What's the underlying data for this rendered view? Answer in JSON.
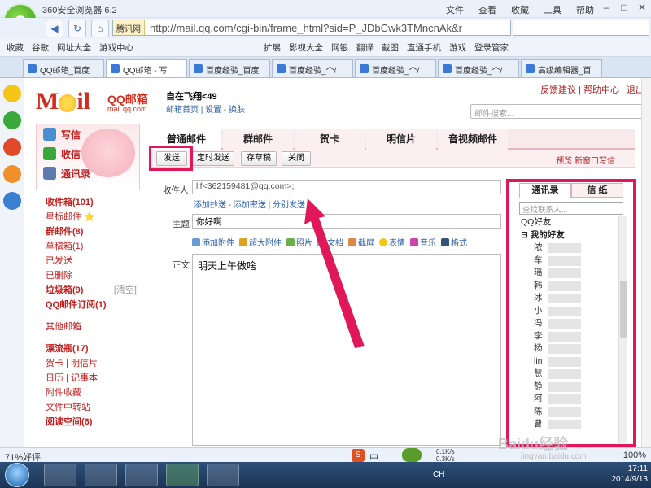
{
  "browser": {
    "title": "360安全浏览器 6.2",
    "menu": [
      "文件",
      "查看",
      "收藏",
      "工具",
      "帮助"
    ],
    "site_badge": "腾讯网",
    "url": "http://mail.qq.com/cgi-bin/frame_html?sid=P_JDbCwk3TMncnAk&r",
    "bookmarks": [
      "收藏",
      "谷歌",
      "网址大全",
      "游戏中心"
    ],
    "bookmarks_right": [
      "扩展",
      "影视大全",
      "网银",
      "翻译",
      "截图",
      "直通手机",
      "游戏",
      "登录管家"
    ],
    "tabs": [
      "QQ邮箱_百度",
      "QQ邮箱 - 写",
      "百度经验_百度",
      "百度经验_个/",
      "百度经验_个/",
      "百度经验_个/",
      "高级编辑器_百"
    ]
  },
  "mail": {
    "logo_text": "QQ邮箱",
    "logo_sub": "mail.qq.com",
    "username": "自在飞翔<49",
    "user_links": "邮箱首页 | 设置 - 换肤",
    "top_links": "反馈建议 | 帮助中心 | 退出",
    "search_placeholder": "邮件搜索...",
    "quick": [
      "写信",
      "收信",
      "通讯录"
    ],
    "folders": [
      {
        "label": "收件箱(101)",
        "bold": true
      },
      {
        "label": "星标邮件 ⭐",
        "bold": false
      },
      {
        "label": "群邮件(8)",
        "bold": true
      },
      {
        "label": "草稿箱(1)",
        "bold": false
      },
      {
        "label": "已发送",
        "bold": false
      },
      {
        "label": "已删除",
        "bold": false
      },
      {
        "label": "垃圾箱(9)",
        "bold": true,
        "extra": "[清空]"
      },
      {
        "label": "QQ邮件订阅(1)",
        "bold": true
      }
    ],
    "other_folders": "其他邮箱",
    "extra_folders": [
      {
        "label": "漂流瓶(17)",
        "bold": true
      },
      {
        "label": "贺卡 | 明信片",
        "bold": false
      },
      {
        "label": "日历 | 记事本",
        "bold": false
      },
      {
        "label": "附件收藏",
        "bold": false
      },
      {
        "label": "文件中转站",
        "bold": false
      },
      {
        "label": "阅读空间(6)",
        "bold": true
      }
    ]
  },
  "compose": {
    "type_tabs": [
      "普通邮件",
      "群邮件",
      "贺卡",
      "明信片",
      "音视频邮件"
    ],
    "buttons": [
      "发送",
      "定时发送",
      "存草稿",
      "关闭"
    ],
    "action_links": "预览  新窗口写信",
    "to_label": "收件人",
    "to_value": "lif<362159481@qq.com>;",
    "cc_links": "添加抄送 - 添加密送 | 分别发送",
    "subject_label": "主题",
    "subject_value": "你好啊",
    "toolbar": [
      "添加附件",
      "超大附件",
      "照片",
      "文档",
      "截屏",
      "表情",
      "音乐",
      "格式"
    ],
    "body_label": "正文",
    "body_text": "明天上午做啥"
  },
  "contacts": {
    "tabs": [
      "通讯录",
      "信 纸"
    ],
    "search_placeholder": "查找联系人...",
    "group_top": "QQ好友",
    "group": "我的好友",
    "items": [
      "浓",
      "车",
      "瑶",
      "韩",
      "冰",
      "小",
      "冯",
      "李",
      "杨",
      "lin",
      "慧",
      "静",
      "阿",
      "陈",
      "曹"
    ]
  },
  "status": {
    "left": "71%好评",
    "speed1": "0.1K/s",
    "speed2": "0.3K/s",
    "ime": "中",
    "zoom": "100%"
  },
  "taskbar": {
    "time": "17:11",
    "date": "2014/9/13",
    "lang": "CH"
  },
  "watermark": "Baidu经验",
  "watermark_sub": "jingyan.baidu.com"
}
